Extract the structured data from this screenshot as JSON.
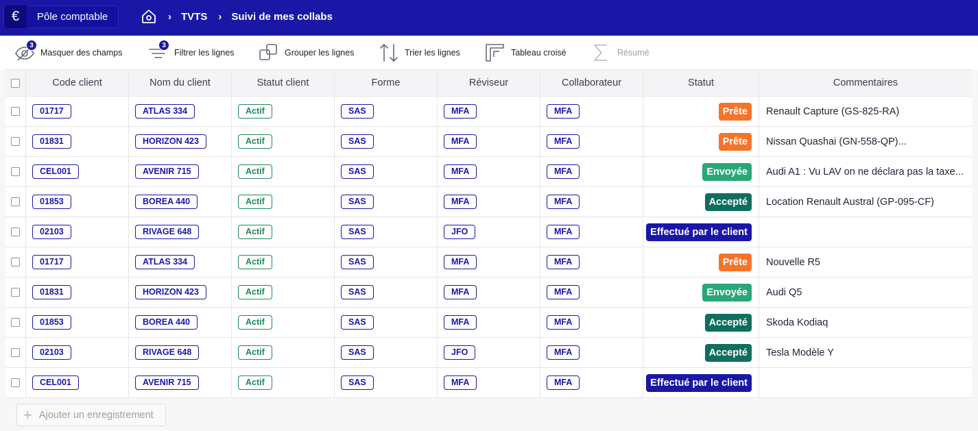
{
  "header": {
    "workspace_icon": "euro-icon",
    "workspace_name": "Pôle comptable",
    "home_icon": "home-icon",
    "breadcrumbs": [
      "TVTS",
      "Suivi de mes collabs"
    ],
    "separator": "›"
  },
  "toolbar": {
    "hide_fields": {
      "label": "Masquer des champs",
      "count": "3",
      "icon": "eye-off-icon"
    },
    "filter": {
      "label": "Filtrer les lignes",
      "count": "3",
      "icon": "filter-icon"
    },
    "group": {
      "label": "Grouper les lignes",
      "icon": "group-icon"
    },
    "sort": {
      "label": "Trier les lignes",
      "icon": "sort-icon"
    },
    "pivot": {
      "label": "Tableau croisé",
      "icon": "pivot-icon"
    },
    "summary": {
      "label": "Résumé",
      "icon": "sigma-icon"
    }
  },
  "table": {
    "columns": [
      "Code client",
      "Nom du client",
      "Statut client",
      "Forme",
      "Réviseur",
      "Collaborateur",
      "Statut",
      "Commentaires"
    ],
    "rows": [
      {
        "code": "01717",
        "name": "ATLAS 334",
        "client_status": "Actif",
        "form": "SAS",
        "reviewer": "MFA",
        "collab": "MFA",
        "status": "Prête",
        "comment": "Renault Capture (GS-825-RA)"
      },
      {
        "code": "01831",
        "name": "HORIZON 423",
        "client_status": "Actif",
        "form": "SAS",
        "reviewer": "MFA",
        "collab": "MFA",
        "status": "Prête",
        "comment": "Nissan Quashai (GN-558-QP)..."
      },
      {
        "code": "CEL001",
        "name": "AVENIR 715",
        "client_status": "Actif",
        "form": "SAS",
        "reviewer": "MFA",
        "collab": "MFA",
        "status": "Envoyée",
        "comment": "Audi A1 : Vu LAV on ne déclara pas la taxe..."
      },
      {
        "code": "01853",
        "name": "BOREA 440",
        "client_status": "Actif",
        "form": "SAS",
        "reviewer": "MFA",
        "collab": "MFA",
        "status": "Accepté",
        "comment": "Location Renault Austral (GP-095-CF)"
      },
      {
        "code": "02103",
        "name": "RIVAGE 648",
        "client_status": "Actif",
        "form": "SAS",
        "reviewer": "JFO",
        "collab": "MFA",
        "status": "Effectué par le client",
        "comment": ""
      },
      {
        "code": "01717",
        "name": "ATLAS 334",
        "client_status": "Actif",
        "form": "SAS",
        "reviewer": "MFA",
        "collab": "MFA",
        "status": "Prête",
        "comment": "Nouvelle R5"
      },
      {
        "code": "01831",
        "name": "HORIZON 423",
        "client_status": "Actif",
        "form": "SAS",
        "reviewer": "MFA",
        "collab": "MFA",
        "status": "Envoyée",
        "comment": "Audi Q5"
      },
      {
        "code": "01853",
        "name": "BOREA 440",
        "client_status": "Actif",
        "form": "SAS",
        "reviewer": "MFA",
        "collab": "MFA",
        "status": "Accepté",
        "comment": "Skoda Kodiaq"
      },
      {
        "code": "02103",
        "name": "RIVAGE 648",
        "client_status": "Actif",
        "form": "SAS",
        "reviewer": "JFO",
        "collab": "MFA",
        "status": "Accepté",
        "comment": "Tesla Modèle Y"
      },
      {
        "code": "CEL001",
        "name": "AVENIR 715",
        "client_status": "Actif",
        "form": "SAS",
        "reviewer": "MFA",
        "collab": "MFA",
        "status": "Effectué par le client",
        "comment": ""
      }
    ]
  },
  "status_colors": {
    "Prête": "#f5742a",
    "Envoyée": "#2aa776",
    "Accepté": "#0f6e5e",
    "Effectué par le client": "#1a17a6"
  },
  "add_record": {
    "label": "Ajouter un enregistrement",
    "icon": "plus-icon"
  }
}
